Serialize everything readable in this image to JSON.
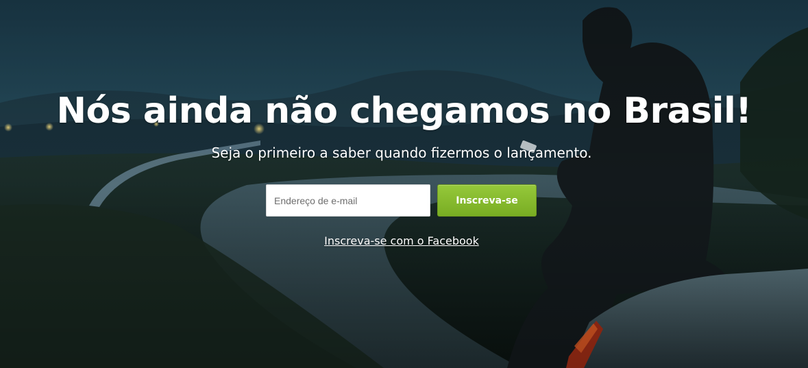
{
  "hero": {
    "headline": "Nós ainda não chegamos no Brasil!",
    "subheadline": "Seja o primeiro a saber quando fizermos o lançamento."
  },
  "form": {
    "email_placeholder": "Endereço de e-mail",
    "submit_label": "Inscreva-se"
  },
  "facebook_link": "Inscreva-se com o Facebook",
  "colors": {
    "button": "#86bb2f",
    "background": "#15232a",
    "text": "#ffffff"
  }
}
